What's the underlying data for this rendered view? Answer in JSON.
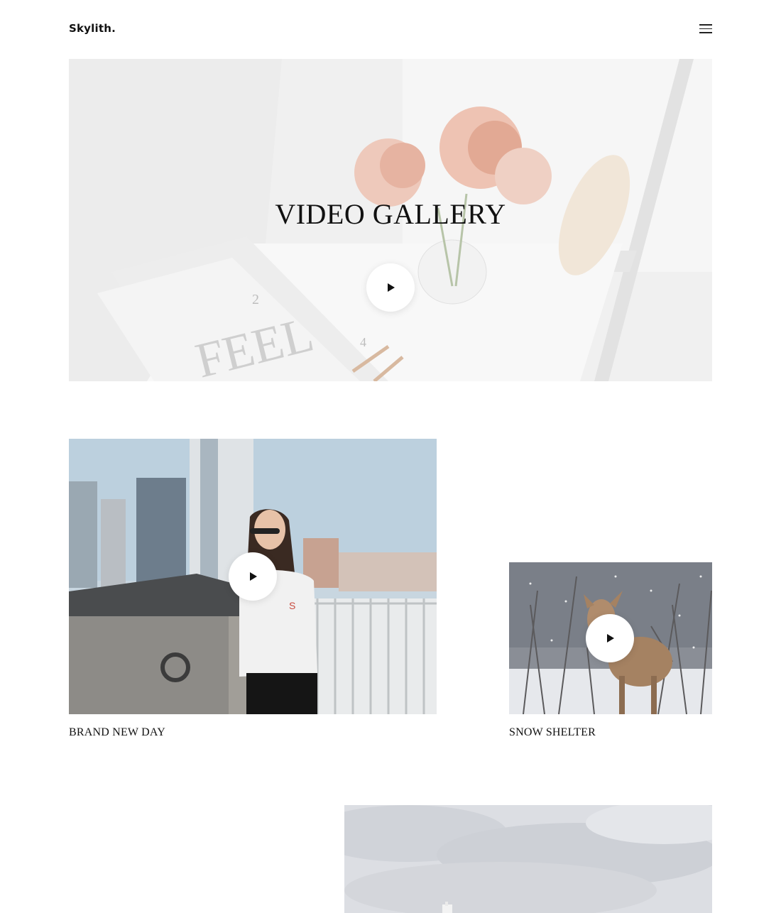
{
  "header": {
    "logo": "Skylith.",
    "menu_icon": "hamburger-menu-icon"
  },
  "hero": {
    "title": "VIDEO GALLERY",
    "play_icon": "play-icon"
  },
  "videos": [
    {
      "title": "BRAND NEW DAY",
      "play_icon": "play-icon"
    },
    {
      "title": "SNOW SHELTER",
      "play_icon": "play-icon"
    },
    {
      "title": ""
    }
  ],
  "colors": {
    "text": "#111111",
    "background": "#ffffff",
    "button": "#ffffff"
  }
}
